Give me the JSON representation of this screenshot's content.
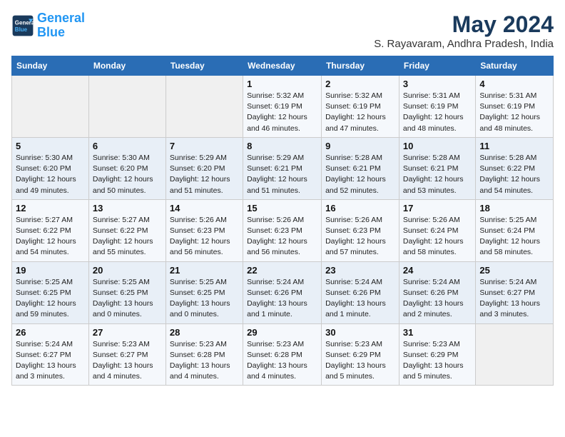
{
  "logo": {
    "line1": "General",
    "line2": "Blue"
  },
  "title": "May 2024",
  "location": "S. Rayavaram, Andhra Pradesh, India",
  "days_of_week": [
    "Sunday",
    "Monday",
    "Tuesday",
    "Wednesday",
    "Thursday",
    "Friday",
    "Saturday"
  ],
  "weeks": [
    [
      {
        "day": "",
        "info": ""
      },
      {
        "day": "",
        "info": ""
      },
      {
        "day": "",
        "info": ""
      },
      {
        "day": "1",
        "info": "Sunrise: 5:32 AM\nSunset: 6:19 PM\nDaylight: 12 hours\nand 46 minutes."
      },
      {
        "day": "2",
        "info": "Sunrise: 5:32 AM\nSunset: 6:19 PM\nDaylight: 12 hours\nand 47 minutes."
      },
      {
        "day": "3",
        "info": "Sunrise: 5:31 AM\nSunset: 6:19 PM\nDaylight: 12 hours\nand 48 minutes."
      },
      {
        "day": "4",
        "info": "Sunrise: 5:31 AM\nSunset: 6:19 PM\nDaylight: 12 hours\nand 48 minutes."
      }
    ],
    [
      {
        "day": "5",
        "info": "Sunrise: 5:30 AM\nSunset: 6:20 PM\nDaylight: 12 hours\nand 49 minutes."
      },
      {
        "day": "6",
        "info": "Sunrise: 5:30 AM\nSunset: 6:20 PM\nDaylight: 12 hours\nand 50 minutes."
      },
      {
        "day": "7",
        "info": "Sunrise: 5:29 AM\nSunset: 6:20 PM\nDaylight: 12 hours\nand 51 minutes."
      },
      {
        "day": "8",
        "info": "Sunrise: 5:29 AM\nSunset: 6:21 PM\nDaylight: 12 hours\nand 51 minutes."
      },
      {
        "day": "9",
        "info": "Sunrise: 5:28 AM\nSunset: 6:21 PM\nDaylight: 12 hours\nand 52 minutes."
      },
      {
        "day": "10",
        "info": "Sunrise: 5:28 AM\nSunset: 6:21 PM\nDaylight: 12 hours\nand 53 minutes."
      },
      {
        "day": "11",
        "info": "Sunrise: 5:28 AM\nSunset: 6:22 PM\nDaylight: 12 hours\nand 54 minutes."
      }
    ],
    [
      {
        "day": "12",
        "info": "Sunrise: 5:27 AM\nSunset: 6:22 PM\nDaylight: 12 hours\nand 54 minutes."
      },
      {
        "day": "13",
        "info": "Sunrise: 5:27 AM\nSunset: 6:22 PM\nDaylight: 12 hours\nand 55 minutes."
      },
      {
        "day": "14",
        "info": "Sunrise: 5:26 AM\nSunset: 6:23 PM\nDaylight: 12 hours\nand 56 minutes."
      },
      {
        "day": "15",
        "info": "Sunrise: 5:26 AM\nSunset: 6:23 PM\nDaylight: 12 hours\nand 56 minutes."
      },
      {
        "day": "16",
        "info": "Sunrise: 5:26 AM\nSunset: 6:23 PM\nDaylight: 12 hours\nand 57 minutes."
      },
      {
        "day": "17",
        "info": "Sunrise: 5:26 AM\nSunset: 6:24 PM\nDaylight: 12 hours\nand 58 minutes."
      },
      {
        "day": "18",
        "info": "Sunrise: 5:25 AM\nSunset: 6:24 PM\nDaylight: 12 hours\nand 58 minutes."
      }
    ],
    [
      {
        "day": "19",
        "info": "Sunrise: 5:25 AM\nSunset: 6:25 PM\nDaylight: 12 hours\nand 59 minutes."
      },
      {
        "day": "20",
        "info": "Sunrise: 5:25 AM\nSunset: 6:25 PM\nDaylight: 13 hours\nand 0 minutes."
      },
      {
        "day": "21",
        "info": "Sunrise: 5:25 AM\nSunset: 6:25 PM\nDaylight: 13 hours\nand 0 minutes."
      },
      {
        "day": "22",
        "info": "Sunrise: 5:24 AM\nSunset: 6:26 PM\nDaylight: 13 hours\nand 1 minute."
      },
      {
        "day": "23",
        "info": "Sunrise: 5:24 AM\nSunset: 6:26 PM\nDaylight: 13 hours\nand 1 minute."
      },
      {
        "day": "24",
        "info": "Sunrise: 5:24 AM\nSunset: 6:26 PM\nDaylight: 13 hours\nand 2 minutes."
      },
      {
        "day": "25",
        "info": "Sunrise: 5:24 AM\nSunset: 6:27 PM\nDaylight: 13 hours\nand 3 minutes."
      }
    ],
    [
      {
        "day": "26",
        "info": "Sunrise: 5:24 AM\nSunset: 6:27 PM\nDaylight: 13 hours\nand 3 minutes."
      },
      {
        "day": "27",
        "info": "Sunrise: 5:23 AM\nSunset: 6:27 PM\nDaylight: 13 hours\nand 4 minutes."
      },
      {
        "day": "28",
        "info": "Sunrise: 5:23 AM\nSunset: 6:28 PM\nDaylight: 13 hours\nand 4 minutes."
      },
      {
        "day": "29",
        "info": "Sunrise: 5:23 AM\nSunset: 6:28 PM\nDaylight: 13 hours\nand 4 minutes."
      },
      {
        "day": "30",
        "info": "Sunrise: 5:23 AM\nSunset: 6:29 PM\nDaylight: 13 hours\nand 5 minutes."
      },
      {
        "day": "31",
        "info": "Sunrise: 5:23 AM\nSunset: 6:29 PM\nDaylight: 13 hours\nand 5 minutes."
      },
      {
        "day": "",
        "info": ""
      }
    ]
  ]
}
